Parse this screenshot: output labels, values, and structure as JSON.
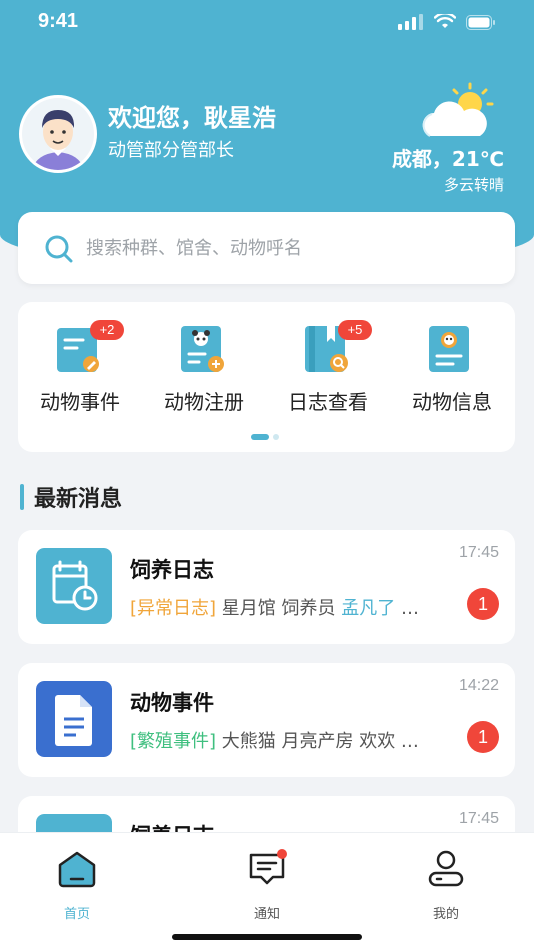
{
  "status_bar": {
    "time": "9:41"
  },
  "header": {
    "greeting": "欢迎您，耿星浩",
    "role": "动管部分管部长",
    "weather": {
      "city_temp": "成都，21℃",
      "desc": "多云转晴",
      "icon": "partly-cloudy-icon"
    }
  },
  "search": {
    "placeholder": "搜索种群、馆舍、动物呼名",
    "value": ""
  },
  "menu": {
    "items": [
      {
        "label": "动物事件",
        "badge": "+2",
        "icon": "animal-event-icon"
      },
      {
        "label": "动物注册",
        "badge": "",
        "icon": "animal-register-icon"
      },
      {
        "label": "日志查看",
        "badge": "+5",
        "icon": "log-view-icon"
      },
      {
        "label": "动物信息",
        "badge": "",
        "icon": "animal-info-icon"
      }
    ],
    "page_indicator": {
      "current": 1,
      "total": 2
    }
  },
  "news": {
    "title": "最新消息",
    "items": [
      {
        "title": "饲养日志",
        "time": "17:45",
        "tag": "[异常日志]",
        "text": " 星月馆 饲养员 ",
        "name": "孟凡了",
        "ellipsis": " …",
        "count": "1"
      },
      {
        "title": "动物事件",
        "time": "14:22",
        "tag": "[繁殖事件]",
        "text": " 大熊猫  月亮产房  欢欢 …",
        "count": "1"
      },
      {
        "title": "饲养日志",
        "time": "17:45"
      }
    ]
  },
  "tabbar": {
    "items": [
      {
        "label": "首页",
        "active": true
      },
      {
        "label": "通知",
        "active": false,
        "has_dot": true
      },
      {
        "label": "我的",
        "active": false
      }
    ]
  },
  "colors": {
    "primary": "#4fb3d1",
    "badge": "#f0463a",
    "tag_orange": "#f0a53a",
    "tag_green": "#3fbf7f",
    "doc_blue": "#3a6fcf"
  }
}
